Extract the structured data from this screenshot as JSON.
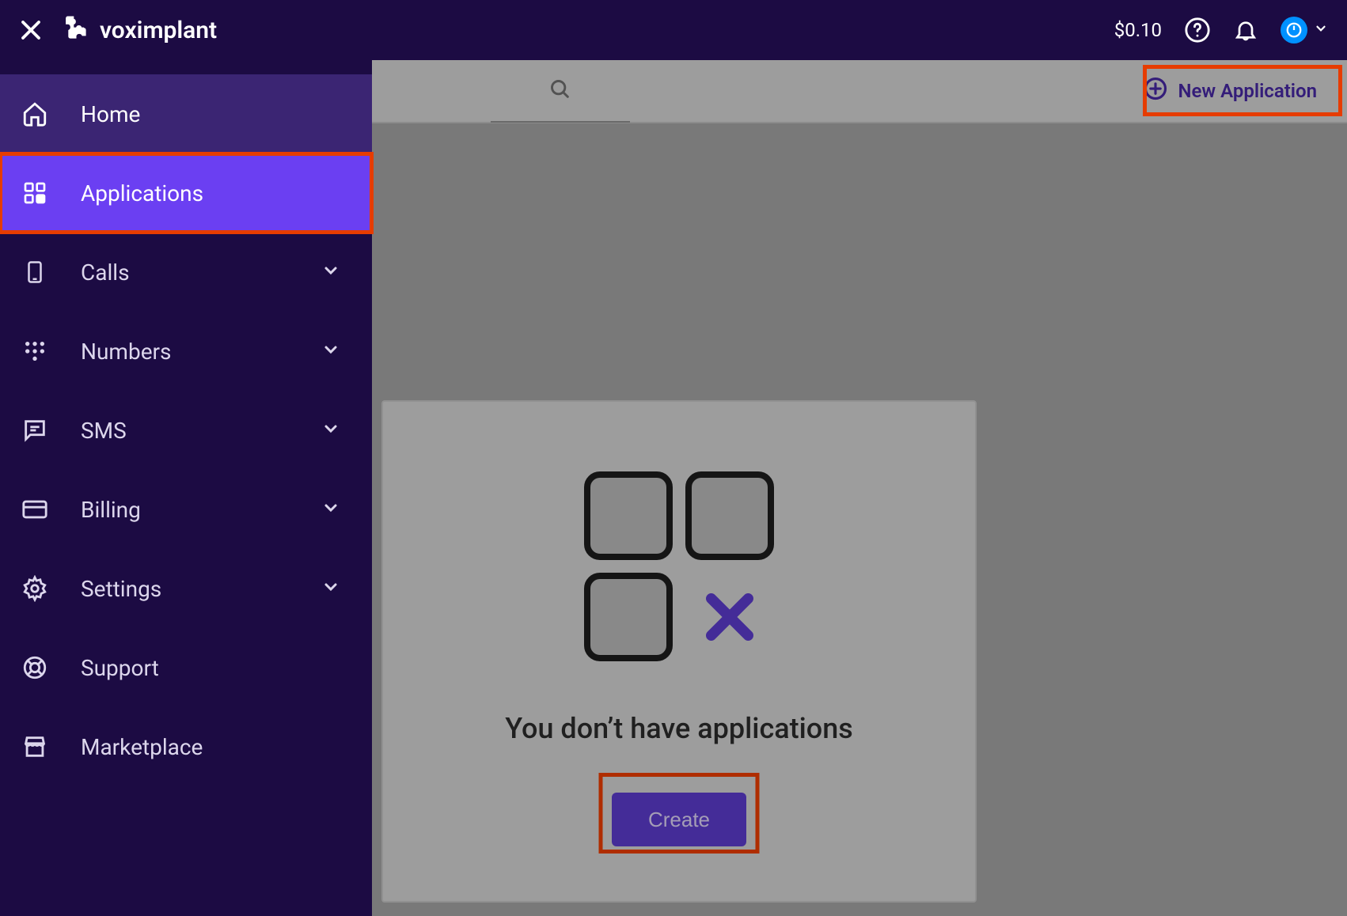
{
  "topbar": {
    "brand": "voximplant",
    "balance": "$0.10"
  },
  "sidebar": {
    "items": [
      {
        "label": "Home",
        "expandable": false
      },
      {
        "label": "Applications",
        "expandable": false
      },
      {
        "label": "Calls",
        "expandable": true
      },
      {
        "label": "Numbers",
        "expandable": true
      },
      {
        "label": "SMS",
        "expandable": true
      },
      {
        "label": "Billing",
        "expandable": true
      },
      {
        "label": "Settings",
        "expandable": true
      },
      {
        "label": "Support",
        "expandable": false
      },
      {
        "label": "Marketplace",
        "expandable": false
      }
    ]
  },
  "toolbar": {
    "new_application_label": "New Application"
  },
  "empty_state": {
    "title": "You don’t have applications",
    "create_label": "Create"
  },
  "highlights": {
    "sidebar_applications": true,
    "new_application": true,
    "create_button": true
  }
}
